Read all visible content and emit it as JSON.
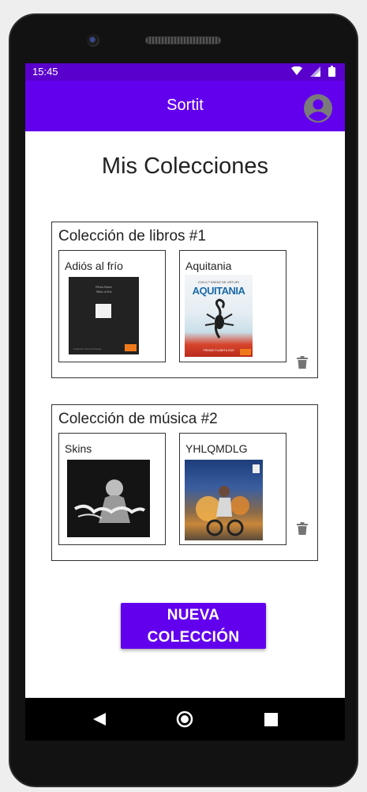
{
  "status": {
    "time": "15:45"
  },
  "appbar": {
    "title": "Sortit"
  },
  "page": {
    "title": "Mis Colecciones"
  },
  "collections": [
    {
      "title": "Colección de libros #1",
      "items": [
        {
          "title": "Adiós al frío",
          "cover_top_text": "Elvira Sastre",
          "cover_sub_text": "Adiós al frío",
          "cover_bottom_text": "Colección Visor de Poesía"
        },
        {
          "title": "Aquitania",
          "cover_author": "EVA G.ª SÁENZ DE URTURI",
          "cover_title": "AQUITANIA",
          "cover_award": "PREMIO PLANETA 2020"
        }
      ]
    },
    {
      "title": "Colección de música #2",
      "items": [
        {
          "title": "Skins"
        },
        {
          "title": "YHLQMDLG"
        }
      ]
    }
  ],
  "actions": {
    "new_collection": "NUEVA COLECCIÓN"
  },
  "colors": {
    "primary": "#6200ee",
    "status_bar": "#5a00cc",
    "icon_grey": "#757575"
  }
}
